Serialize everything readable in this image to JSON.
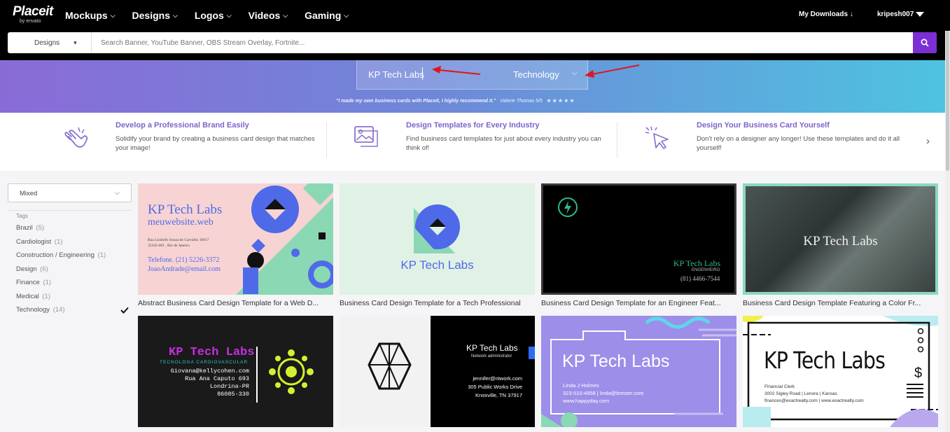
{
  "nav": {
    "logo": "Placeit",
    "logo_sub": "by envato",
    "links": [
      "Mockups",
      "Designs",
      "Logos",
      "Videos",
      "Gaming"
    ],
    "my_downloads": "My Downloads",
    "username": "kripesh007"
  },
  "search": {
    "category": "Designs",
    "placeholder": "Search Banner, YouTube Banner, OBS Stream Overlay, Fortnite..."
  },
  "hero": {
    "name_value": "KP Tech Labs",
    "industry_value": "Technology",
    "testimonial": "\"I made my own business cards with Placeit, I highly recommend it.\"",
    "testimonial_author": "Valerie Thomas 5/5",
    "stars": "★★★★★"
  },
  "features": [
    {
      "title": "Develop a Professional Brand Easily",
      "text": "Solidify your brand by creating a business card design that matches your image!"
    },
    {
      "title": "Design Templates for Every Industry",
      "text": "Find business card templates for just about every industry you can think of!"
    },
    {
      "title": "Design Your Business Card Yourself",
      "text": "Don't rely on a designer any longer! Use these templates and do it all yourself!"
    }
  ],
  "sidebar": {
    "sort_value": "Mixed",
    "tags_label": "Tags",
    "tags": [
      {
        "name": "Brazil",
        "count": "(5)"
      },
      {
        "name": "Cardiologist",
        "count": "(1)"
      },
      {
        "name": "Construction / Engineering",
        "count": "(1)"
      },
      {
        "name": "Design",
        "count": "(6)"
      },
      {
        "name": "Finance",
        "count": "(1)"
      },
      {
        "name": "Medical",
        "count": "(1)"
      },
      {
        "name": "Technology",
        "count": "(14)"
      }
    ]
  },
  "cards": [
    {
      "caption": "Abstract Business Card Design Template for a Web D...",
      "brand": "KP Tech Labs",
      "line1": "meuwebsite.web",
      "line2": "Rua Lindolfo Souza de Carvalho 10017",
      "line3": "35102-001 , Rio de Janeiro",
      "line4": "Telefone. (21) 5226-3372",
      "line5": "JoaoAndrade@email.com"
    },
    {
      "caption": "Business Card Design Template for a Tech Professional",
      "brand": "KP Tech Labs"
    },
    {
      "caption": "Business Card Design Template for an Engineer Feat...",
      "brand": "KP Tech Labs",
      "line1": "ENGENHEIRO",
      "line2": "(81) 4466-7544"
    },
    {
      "caption": "Business Card Design Template Featuring a Color Fr...",
      "brand": "KP Tech Labs"
    },
    {
      "brand": "KP Tech Labs",
      "line1": "TECNOLOGA CARDIOVASCULAR",
      "line2": "Giovana@kellycohen.com",
      "line3": "Rua Ana Caputo 693",
      "line4": "Londrina-PR",
      "line5": "86085-330"
    },
    {
      "brand": "KP Tech Labs",
      "line1": "Network administrator",
      "line2": "jennifer@ntwork.com",
      "line3": "305 Public Works Drive",
      "line4": "Knoxville, TN 37917"
    },
    {
      "brand": "KP Tech Labs",
      "line1": "Linda J Holmes",
      "line2": "323-510-4958 | linda@brester.com",
      "line3": "www.happyday.com"
    },
    {
      "brand": "KP Tech Labs",
      "line1": "Financial Clerk",
      "line2": "3002 Sigley Road | Lenora | Kansas",
      "line3": "finances@exactrealty.com | www.exactrealty.com"
    }
  ]
}
